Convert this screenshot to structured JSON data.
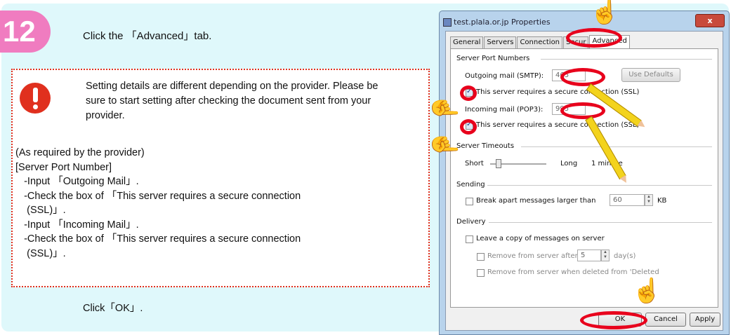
{
  "step": {
    "number": "12",
    "instruction": "Click the 「Advanced」tab."
  },
  "note": {
    "warning": "Setting details are different depending on the provider. Please be sure to start setting after checking the document sent from your provider.",
    "lines": [
      "(As required by the provider)",
      "[Server Port Number]",
      "   -Input 「Outgoing Mail」.",
      "   -Check the box of 「This server requires a secure connection",
      "    (SSL)」.",
      "   -Input 「Incoming Mail」.",
      "   -Check the box of 「This server requires a secure connection",
      "    (SSL)」."
    ]
  },
  "final_instruction": "Click「OK」.",
  "colors": {
    "badge": "#f07cc0",
    "highlight": "#e8001c",
    "panel": "#dff8fb",
    "dotted_border": "#e0301e"
  },
  "dialog": {
    "title": "test.plala.or.jp Properties",
    "close_label": "x",
    "tabs": [
      "General",
      "Servers",
      "Connection",
      "Secur",
      "Advanced"
    ],
    "active_tab": "Advanced",
    "server_ports": {
      "group_label": "Server Port Numbers",
      "outgoing_label": "Outgoing mail (SMTP):",
      "outgoing_value": "465",
      "use_defaults_label": "Use Defaults",
      "smtp_ssl_label": "This server requires a secure connection (SSL)",
      "smtp_ssl_checked": true,
      "incoming_label": "Incoming mail (POP3):",
      "incoming_value": "995",
      "pop_ssl_label": "This server requires a secure connection (SSL)",
      "pop_ssl_checked": true
    },
    "timeouts": {
      "group_label": "Server Timeouts",
      "short_label": "Short",
      "long_label": "Long",
      "value": "1 minute"
    },
    "sending": {
      "group_label": "Sending",
      "break_apart_label": "Break apart messages larger than",
      "break_apart_checked": false,
      "size_value": "60",
      "size_unit": "KB"
    },
    "delivery": {
      "group_label": "Delivery",
      "leave_copy_label": "Leave a copy of messages on server",
      "leave_copy_checked": false,
      "remove_after_label": "Remove from server after",
      "remove_after_value": "5",
      "remove_after_unit": "day(s)",
      "remove_deleted_label": "Remove from server when deleted from 'Deleted"
    },
    "buttons": {
      "ok": "OK",
      "cancel": "Cancel",
      "apply": "Apply"
    }
  }
}
